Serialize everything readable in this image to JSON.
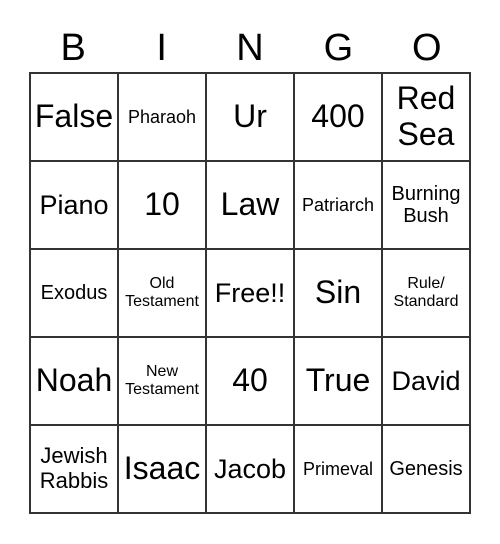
{
  "header": [
    "B",
    "I",
    "N",
    "G",
    "O"
  ],
  "cells": [
    [
      "False",
      "Pharaoh",
      "Ur",
      "400",
      "Red Sea"
    ],
    [
      "Piano",
      "10",
      "Law",
      "Patriarch",
      "Burning Bush"
    ],
    [
      "Exodus",
      "Old Testament",
      "Free!!",
      "Sin",
      "Rule/ Standard"
    ],
    [
      "Noah",
      "New Testament",
      "40",
      "True",
      "David"
    ],
    [
      "Jewish Rabbis",
      "Isaac",
      "Jacob",
      "Primeval",
      "Genesis"
    ]
  ]
}
